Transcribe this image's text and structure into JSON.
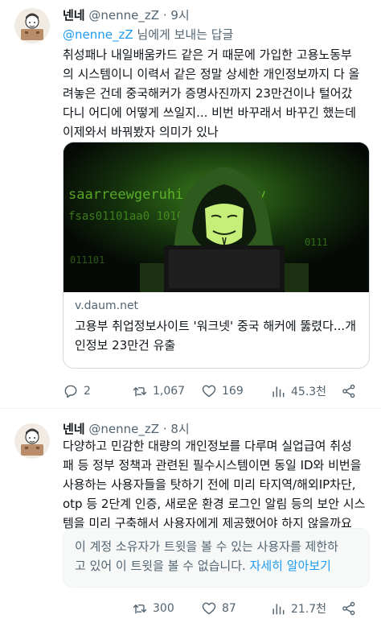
{
  "tweet1": {
    "name": "넨네",
    "handle": "@nenne_zZ",
    "separator": "·",
    "time": "9시",
    "reply_mention": "@nenne_zZ",
    "reply_suffix": " 님에게 보내는 답글",
    "text_lines": [
      "취성패나 내일배움카드 같은 거 때문에 가입한 고용노동부",
      "의 시스템이니 이력서 같은 정말 상세한 개인정보까지 다 올",
      "려놓은 건데 중국해커가 증명사진까지 23만건이나 털어갔",
      "다니 어디에 어떻게 쓰일지... 비번 바꾸래서 바꾸긴 했는데",
      "이제와서 바꿔봤자 의미가 있나"
    ],
    "card": {
      "domain": "v.daum.net",
      "title_lines": [
        "고용부 취업정보사이트 '워크넷' 중국 해커에 뚫렸다...개",
        "인정보 23만건 유출"
      ],
      "image_text_1": "saarreewgeruhi  idnfuovny",
      "image_text_2": "fsas01101aa0       1010",
      "image_text_3": "0111",
      "image_text_4": "011101"
    },
    "actions": {
      "replies": "2",
      "retweets": "1,067",
      "likes": "169",
      "views": "45.3천"
    }
  },
  "tweet2": {
    "name": "넨네",
    "handle": "@nenne_zZ",
    "separator": "·",
    "time": "8시",
    "text_lines": [
      "다양하고 민감한 대량의 개인정보를 다루며 실업급여 취성",
      "패 등 정부 정책과 관련된 필수시스템이면 동일 ID와 비번을",
      "사용하는 사용자들을 탓하기 전에 미리 타지역/해외IP차단,",
      "otp 등 2단계 인증, 새로운 환경 로그인 알림 등의 보안 시스",
      "템을 미리 구축해서 사용자에게 제공했어야 하지 않을까요"
    ],
    "restricted_line1": "이 계정 소유자가 트윗을 볼 수 있는 사용자를 제한하",
    "restricted_line2": "고 있어 이 트윗을 볼 수 없습니다. ",
    "restricted_link": "자세히 알아보기",
    "actions": {
      "retweets": "300",
      "likes": "87",
      "views": "21.7천"
    }
  },
  "colors": {
    "accent": "#1d9bf0",
    "muted": "#536471",
    "text": "#0f1419",
    "border": "#cfd9de"
  }
}
